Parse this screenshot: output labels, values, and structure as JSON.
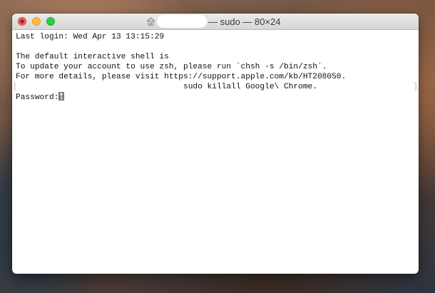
{
  "window": {
    "title_suffix": "— sudo — 80×24"
  },
  "terminal": {
    "lines": [
      "Last login: Wed Apr 13 13:15:29",
      "",
      "The default interactive shell is",
      "To update your account to use zsh, please run `chsh -s /bin/zsh`.",
      "For more details, please visit https://support.apple.com/kb/HT208050.",
      "                                   sudo killall Google\\ Chrome.",
      "Password:"
    ]
  },
  "colors": {
    "close": "#fc605c",
    "minimize": "#fdbc40",
    "maximize": "#34c84a",
    "cursor": "#7a7a7a"
  },
  "icons": {
    "title": "home-folder-icon",
    "cursor": "key-icon"
  }
}
